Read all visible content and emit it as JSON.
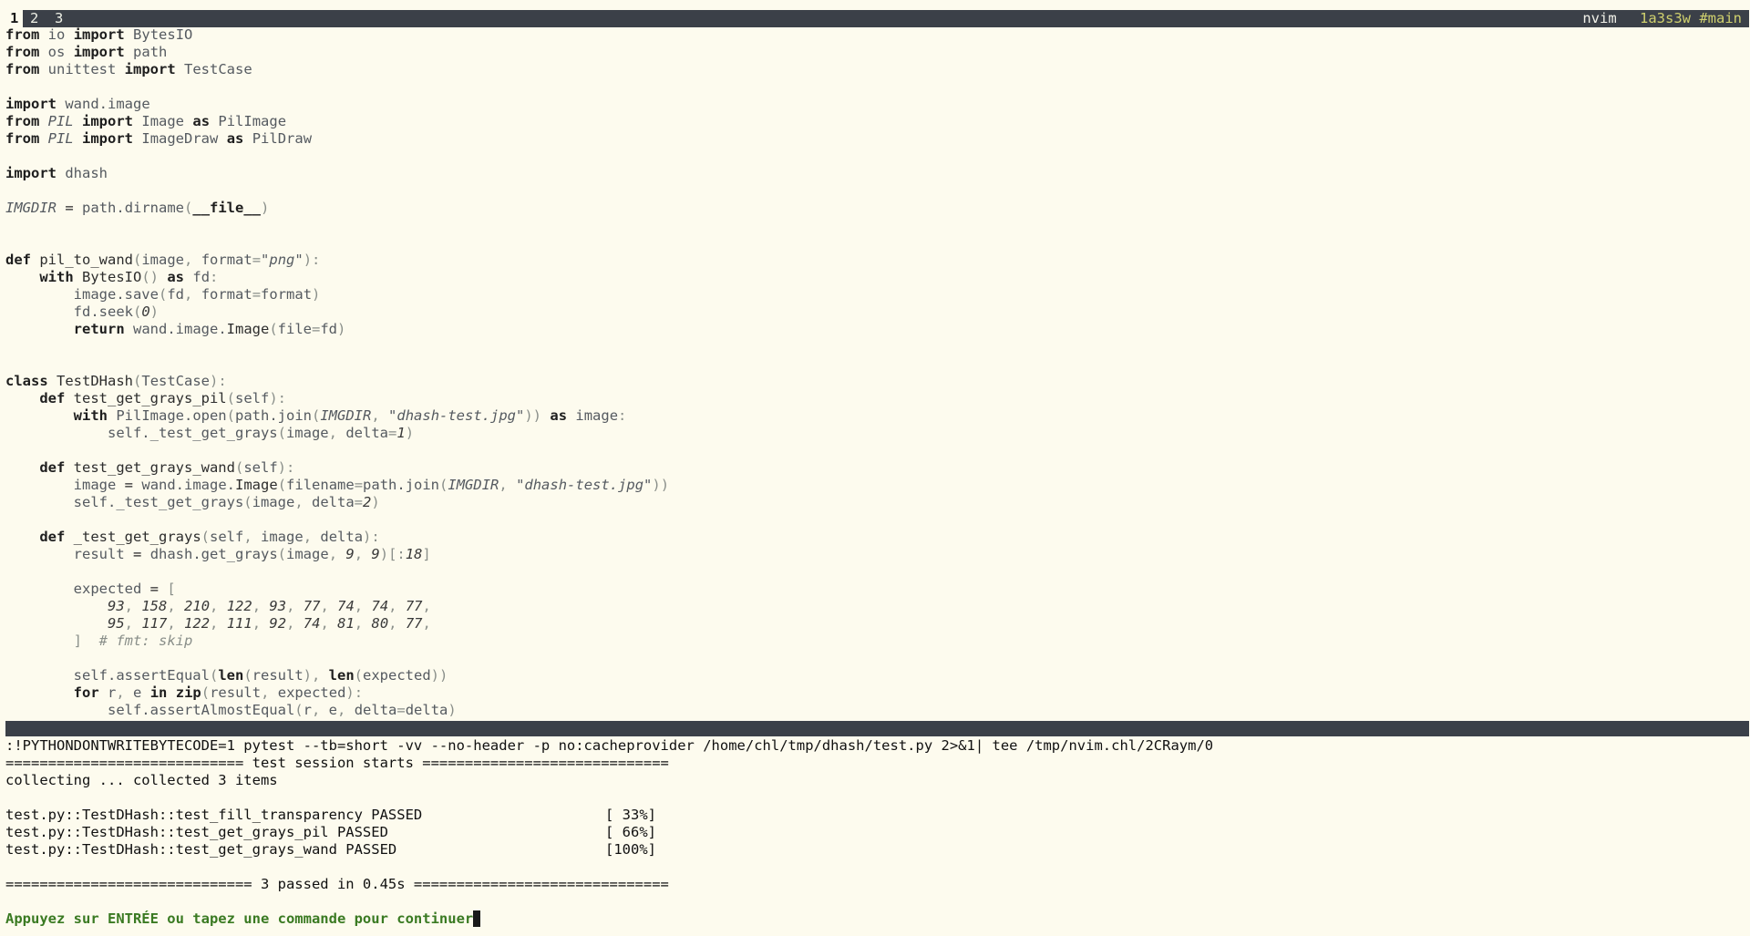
{
  "tabline": {
    "tabs": [
      "1",
      "2",
      "3"
    ],
    "app": "nvim",
    "session": "1a3s3w #main"
  },
  "code_lines": [
    "from io import BytesIO",
    "from os import path",
    "from unittest import TestCase",
    "",
    "import wand.image",
    "from PIL import Image as PilImage",
    "from PIL import ImageDraw as PilDraw",
    "",
    "import dhash",
    "",
    "IMGDIR = path.dirname(__file__)",
    "",
    "",
    "def pil_to_wand(image, format=\"png\"):",
    "    with BytesIO() as fd:",
    "        image.save(fd, format=format)",
    "        fd.seek(0)",
    "        return wand.image.Image(file=fd)",
    "",
    "",
    "class TestDHash(TestCase):",
    "    def test_get_grays_pil(self):",
    "        with PilImage.open(path.join(IMGDIR, \"dhash-test.jpg\")) as image:",
    "            self._test_get_grays(image, delta=1)",
    "",
    "    def test_get_grays_wand(self):",
    "        image = wand.image.Image(filename=path.join(IMGDIR, \"dhash-test.jpg\"))",
    "        self._test_get_grays(image, delta=2)",
    "",
    "    def _test_get_grays(self, image, delta):",
    "        result = dhash.get_grays(image, 9, 9)[:18]",
    "",
    "        expected = [",
    "            93, 158, 210, 122, 93, 77, 74, 74, 77,",
    "            95, 117, 122, 111, 92, 74, 81, 80, 77,",
    "        ]  # fmt: skip",
    "",
    "        self.assertEqual(len(result), len(expected))",
    "        for r, e in zip(result, expected):",
    "            self.assertAlmostEqual(r, e, delta=delta)"
  ],
  "messages": {
    "command": ":!PYTHONDONTWRITEBYTECODE=1 pytest --tb=short -vv --no-header -p no:cacheprovider /home/chl/tmp/dhash/test.py 2>&1| tee /tmp/nvim.chl/2CRaym/0",
    "session_start": "============================ test session starts =============================",
    "collecting": "collecting ... collected 3 items",
    "results": [
      {
        "test": "test.py::TestDHash::test_fill_transparency PASSED",
        "pct": "[ 33%]"
      },
      {
        "test": "test.py::TestDHash::test_get_grays_pil PASSED",
        "pct": "[ 66%]"
      },
      {
        "test": "test.py::TestDHash::test_get_grays_wand PASSED",
        "pct": "[100%]"
      }
    ],
    "summary": "============================= 3 passed in 0.45s ==============================",
    "prompt": "Appuyez sur ENTRÉE ou tapez une commande pour continuer"
  }
}
